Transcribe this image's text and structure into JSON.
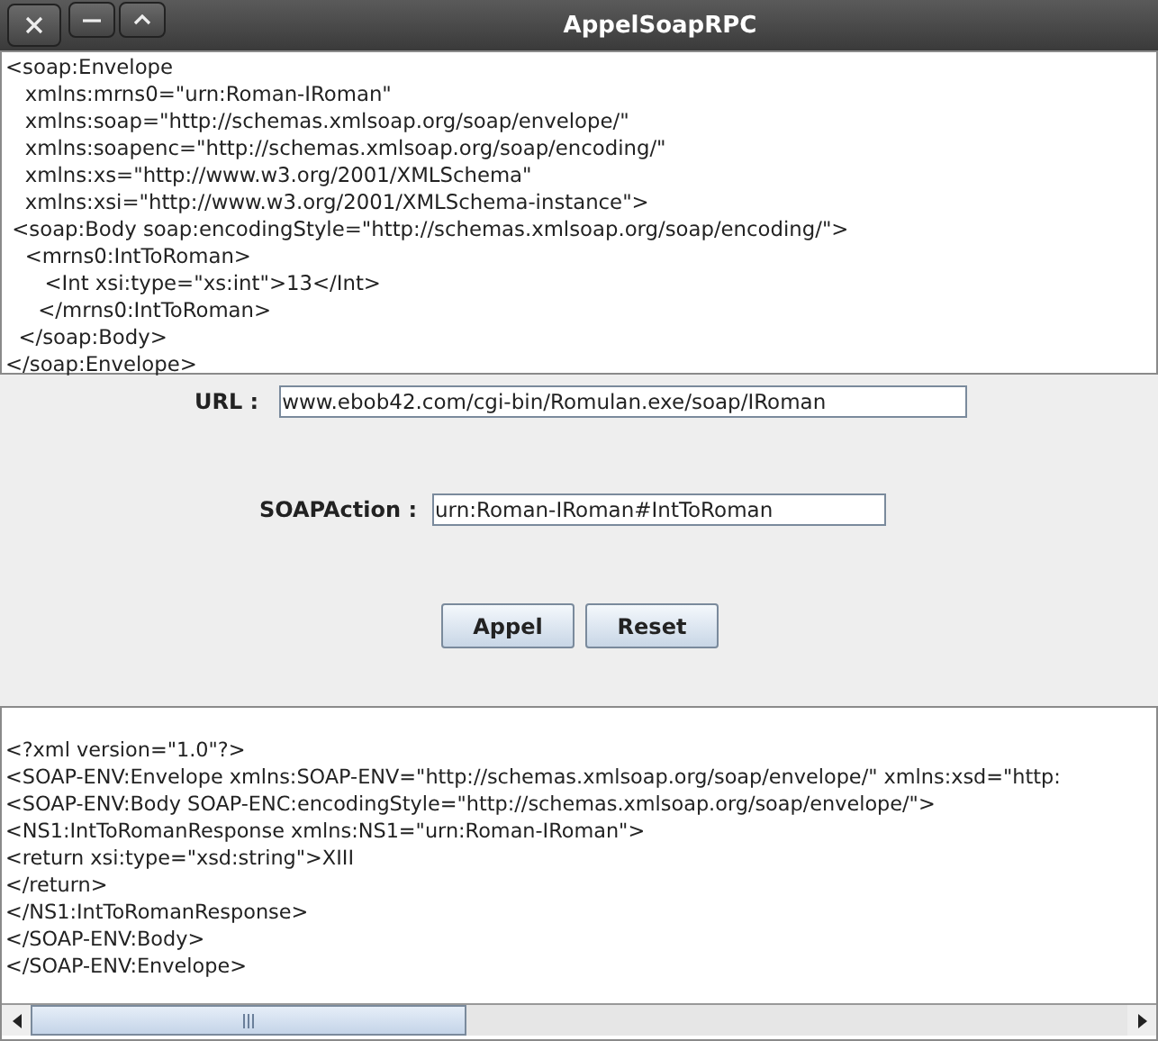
{
  "window": {
    "title": "AppelSoapRPC"
  },
  "request": {
    "lines": [
      "<soap:Envelope",
      "   xmlns:mrns0=\"urn:Roman-IRoman\"",
      "   xmlns:soap=\"http://schemas.xmlsoap.org/soap/envelope/\"",
      "   xmlns:soapenc=\"http://schemas.xmlsoap.org/soap/encoding/\"",
      "   xmlns:xs=\"http://www.w3.org/2001/XMLSchema\"",
      "   xmlns:xsi=\"http://www.w3.org/2001/XMLSchema-instance\">",
      " <soap:Body soap:encodingStyle=\"http://schemas.xmlsoap.org/soap/encoding/\">",
      "   <mrns0:IntToRoman>",
      "      <Int xsi:type=\"xs:int\">13</Int>",
      "     </mrns0:IntToRoman>",
      "  </soap:Body>",
      "</soap:Envelope>"
    ]
  },
  "form": {
    "url": {
      "label": "URL :",
      "value": "www.ebob42.com/cgi-bin/Romulan.exe/soap/IRoman"
    },
    "soap_action": {
      "label": "SOAPAction :",
      "value": "urn:Roman-IRoman#IntToRoman"
    },
    "buttons": [
      "Appel",
      "Reset"
    ]
  },
  "response": {
    "lines": [
      "<?xml version=\"1.0\"?>",
      "<SOAP-ENV:Envelope xmlns:SOAP-ENV=\"http://schemas.xmlsoap.org/soap/envelope/\" xmlns:xsd=\"http:",
      "<SOAP-ENV:Body SOAP-ENC:encodingStyle=\"http://schemas.xmlsoap.org/soap/envelope/\">",
      "<NS1:IntToRomanResponse xmlns:NS1=\"urn:Roman-IRoman\">",
      "<return xsi:type=\"xsd:string\">XIII",
      "</return>",
      "</NS1:IntToRomanResponse>",
      "</SOAP-ENV:Body>",
      "</SOAP-ENV:Envelope>"
    ]
  }
}
